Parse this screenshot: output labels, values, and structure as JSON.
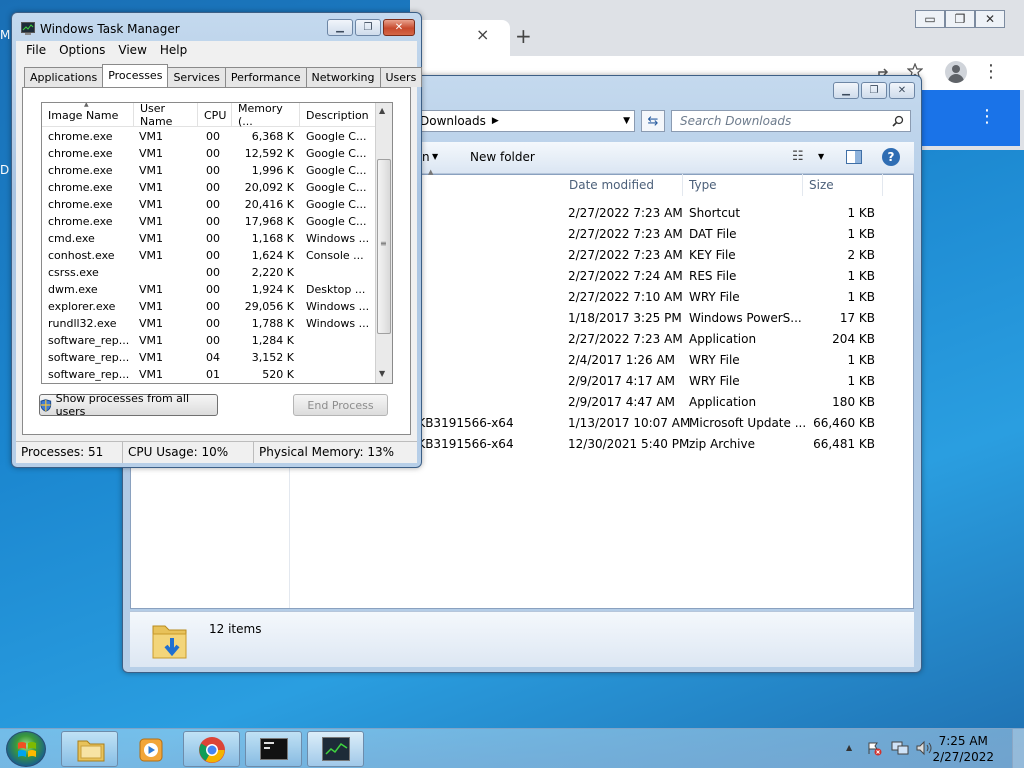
{
  "desktop": {
    "edge_letters": [
      "M",
      "D"
    ]
  },
  "browser": {
    "tab_close": "×",
    "new_tab": "+",
    "controls": [
      "▭",
      "❐",
      "✕"
    ],
    "more_icon": "⋮"
  },
  "explorer": {
    "breadcrumb": "Downloads",
    "search_placeholder": "Search Downloads",
    "toolbar": {
      "partial_label": "n",
      "new_folder": "New folder"
    },
    "columns": {
      "date": "Date modified",
      "type": "Type",
      "size": "Size"
    },
    "files": [
      {
        "name": "",
        "date": "2/27/2022 7:23 AM",
        "type": "Shortcut",
        "size": "1 KB"
      },
      {
        "name": "",
        "date": "2/27/2022 7:23 AM",
        "type": "DAT File",
        "size": "1 KB"
      },
      {
        "name": "",
        "date": "2/27/2022 7:23 AM",
        "type": "KEY File",
        "size": "2 KB"
      },
      {
        "name": "",
        "date": "2/27/2022 7:24 AM",
        "type": "RES File",
        "size": "1 KB"
      },
      {
        "name": "",
        "date": "2/27/2022 7:10 AM",
        "type": "WRY File",
        "size": "1 KB"
      },
      {
        "name": "",
        "date": "1/18/2017 3:25 PM",
        "type": "Windows PowerS...",
        "size": "17 KB"
      },
      {
        "name": "",
        "date": "2/27/2022 7:23 AM",
        "type": "Application",
        "size": "204 KB"
      },
      {
        "name": "",
        "date": "2/4/2017 1:26 AM",
        "type": "WRY File",
        "size": "1 KB"
      },
      {
        "name": "",
        "date": "2/9/2017 4:17 AM",
        "type": "WRY File",
        "size": "1 KB"
      },
      {
        "name": "",
        "date": "2/9/2017 4:47 AM",
        "type": "Application",
        "size": "180 KB"
      },
      {
        "name": "-KB3191566-x64",
        "date": "1/13/2017 10:07 AM",
        "type": "Microsoft Update ...",
        "size": "66,460 KB"
      },
      {
        "name": "-KB3191566-x64",
        "date": "12/30/2021 5:40 PM",
        "type": "zip Archive",
        "size": "66,481 KB"
      }
    ],
    "status": "12 items"
  },
  "taskmgr": {
    "title": "Windows Task Manager",
    "menu": [
      "File",
      "Options",
      "View",
      "Help"
    ],
    "tabs": [
      "Applications",
      "Processes",
      "Services",
      "Performance",
      "Networking",
      "Users"
    ],
    "active_tab": "Processes",
    "columns": {
      "image": "Image Name",
      "user": "User Name",
      "cpu": "CPU",
      "mem": "Memory (...",
      "desc": "Description"
    },
    "processes": [
      {
        "image": "chrome.exe",
        "user": "VM1",
        "cpu": "00",
        "mem": "6,368 K",
        "desc": "Google C..."
      },
      {
        "image": "chrome.exe",
        "user": "VM1",
        "cpu": "00",
        "mem": "12,592 K",
        "desc": "Google C..."
      },
      {
        "image": "chrome.exe",
        "user": "VM1",
        "cpu": "00",
        "mem": "1,996 K",
        "desc": "Google C..."
      },
      {
        "image": "chrome.exe",
        "user": "VM1",
        "cpu": "00",
        "mem": "20,092 K",
        "desc": "Google C..."
      },
      {
        "image": "chrome.exe",
        "user": "VM1",
        "cpu": "00",
        "mem": "20,416 K",
        "desc": "Google C..."
      },
      {
        "image": "chrome.exe",
        "user": "VM1",
        "cpu": "00",
        "mem": "17,968 K",
        "desc": "Google C..."
      },
      {
        "image": "cmd.exe",
        "user": "VM1",
        "cpu": "00",
        "mem": "1,168 K",
        "desc": "Windows ..."
      },
      {
        "image": "conhost.exe",
        "user": "VM1",
        "cpu": "00",
        "mem": "1,624 K",
        "desc": "Console ..."
      },
      {
        "image": "csrss.exe",
        "user": "",
        "cpu": "00",
        "mem": "2,220 K",
        "desc": ""
      },
      {
        "image": "dwm.exe",
        "user": "VM1",
        "cpu": "00",
        "mem": "1,924 K",
        "desc": "Desktop ..."
      },
      {
        "image": "explorer.exe",
        "user": "VM1",
        "cpu": "00",
        "mem": "29,056 K",
        "desc": "Windows ..."
      },
      {
        "image": "rundll32.exe",
        "user": "VM1",
        "cpu": "00",
        "mem": "1,788 K",
        "desc": "Windows ..."
      },
      {
        "image": "software_rep...",
        "user": "VM1",
        "cpu": "00",
        "mem": "1,284 K",
        "desc": ""
      },
      {
        "image": "software_rep...",
        "user": "VM1",
        "cpu": "04",
        "mem": "3,152 K",
        "desc": ""
      },
      {
        "image": "software_rep...",
        "user": "VM1",
        "cpu": "01",
        "mem": "520 K",
        "desc": ""
      }
    ],
    "show_all_btn": "Show processes from all users",
    "end_process_btn": "End Process",
    "status": {
      "processes": "Processes: 51",
      "cpu": "CPU Usage: 10%",
      "memory": "Physical Memory: 13%"
    }
  },
  "taskbar": {
    "clock_time": "7:25 AM",
    "clock_date": "2/27/2022",
    "tray_arrow": "▲"
  }
}
